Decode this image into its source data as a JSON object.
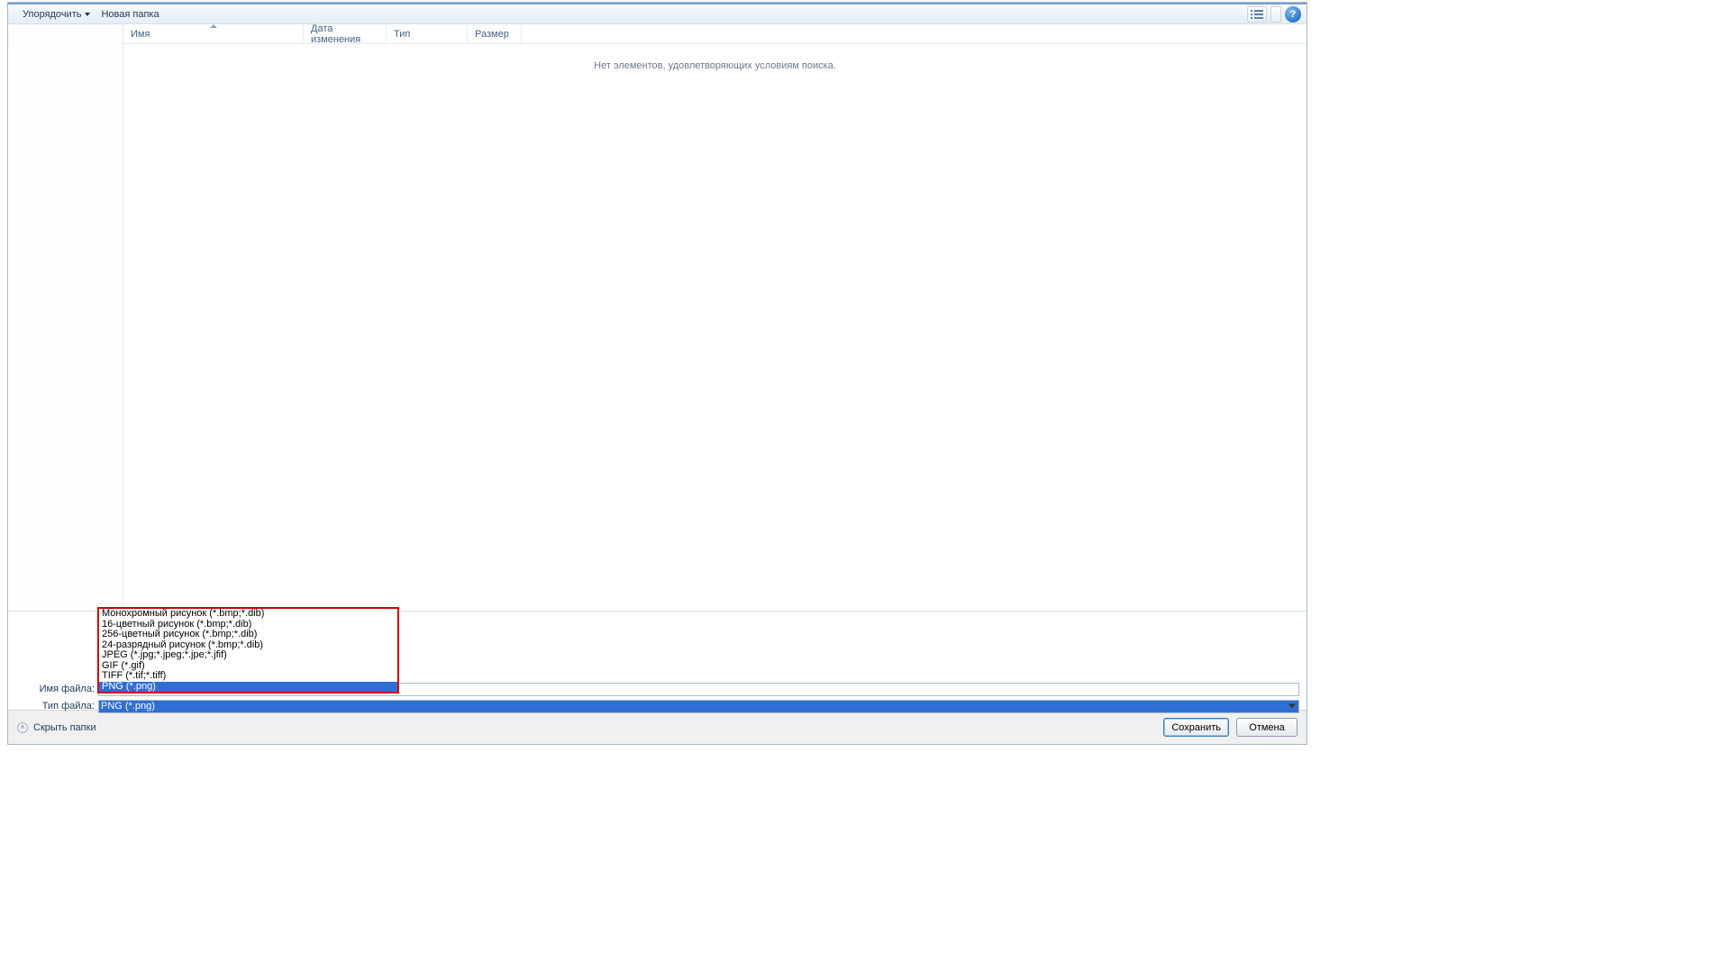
{
  "toolbar": {
    "organize_label": "Упорядочить",
    "newfolder_label": "Новая папка"
  },
  "columns": {
    "name": "Имя",
    "date": "Дата изменения",
    "type": "Тип",
    "size": "Размер"
  },
  "empty_message": "Нет элементов, удовлетворяющих условиям поиска.",
  "form": {
    "filename_label": "Имя файла:",
    "filetype_label": "Тип файла:",
    "filetype_selected": "PNG (*.png)",
    "filetype_options": [
      "Монохромный рисунок (*.bmp;*.dib)",
      "16-цветный рисунок (*.bmp;*.dib)",
      "256-цветный рисунок (*.bmp;*.dib)",
      "24-разрядный рисунок (*.bmp;*.dib)",
      "JPEG (*.jpg;*.jpeg;*.jpe;*.jfif)",
      "GIF (*.gif)",
      "TIFF (*.tif;*.tiff)",
      "PNG (*.png)"
    ],
    "filetype_selected_index": 7
  },
  "footer": {
    "hide_folders": "Скрыть папки",
    "save": "Сохранить",
    "cancel": "Отмена"
  }
}
